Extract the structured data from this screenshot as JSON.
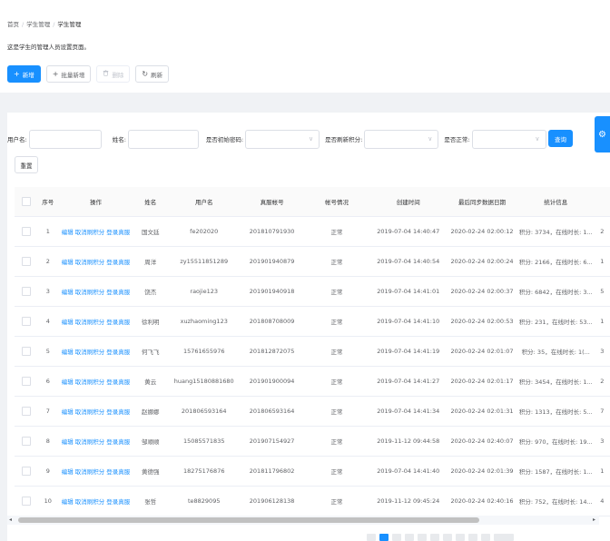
{
  "breadcrumb": [
    "首页",
    "学生管理",
    "学生管理"
  ],
  "description": "这是学生的管理人员设置页面。",
  "toolbar": {
    "add": "新增",
    "batch_add": "批量新增",
    "delete": "删除",
    "refresh": "刷新"
  },
  "filters": {
    "username_label": "用户名:",
    "name_label": "姓名:",
    "init_pwd_label": "是否初始密码:",
    "reset_points_label": "是否刷新积分:",
    "normal_label": "是否正常:",
    "query": "查询",
    "reset": "重置"
  },
  "icons": {
    "add": "plus-icon",
    "batch_add": "plus-icon",
    "delete": "trash-icon",
    "refresh": "refresh-icon",
    "select": "chevron-down-icon",
    "settings": "gear-icon"
  },
  "colors": {
    "primary": "#1890ff"
  },
  "table": {
    "headers": [
      "",
      "序号",
      "操作",
      "姓名",
      "用户名",
      "真服帐号",
      "帐号情况",
      "创建时间",
      "最后同步数据日期",
      "统计信息"
    ],
    "actions": [
      "编辑",
      "取消刷积分",
      "登录真服"
    ],
    "rows": [
      {
        "idx": "1",
        "name": "国文廷",
        "username": "fe202020",
        "account": "201810791930",
        "status": "正常",
        "created": "2019-07-04 14:40:47",
        "synced": "2020-02-24 02:00:12",
        "stats": "积分: 3734，在线时长: 1...",
        "extra": "2"
      },
      {
        "idx": "2",
        "name": "周洋",
        "username": "zy15511851289",
        "account": "201901940879",
        "status": "正常",
        "created": "2019-07-04 14:40:54",
        "synced": "2020-02-24 02:00:24",
        "stats": "积分: 2166，在线时长: 6...",
        "extra": "1"
      },
      {
        "idx": "3",
        "name": "饶杰",
        "username": "raojie123",
        "account": "201901940918",
        "status": "正常",
        "created": "2019-07-04 14:41:01",
        "synced": "2020-02-24 02:00:37",
        "stats": "积分: 6842，在线时长: 3...",
        "extra": "5"
      },
      {
        "idx": "4",
        "name": "徐利明",
        "username": "xuzhaoming123",
        "account": "201808708009",
        "status": "正常",
        "created": "2019-07-04 14:41:10",
        "synced": "2020-02-24 02:00:53",
        "stats": "积分: 231，在线时长: 53...",
        "extra": "1"
      },
      {
        "idx": "5",
        "name": "何飞飞",
        "username": "15761655976",
        "account": "201812872075",
        "status": "正常",
        "created": "2019-07-04 14:41:19",
        "synced": "2020-02-24 02:01:07",
        "stats": "积分: 35，在线时长: 1(...",
        "extra": "3"
      },
      {
        "idx": "6",
        "name": "黄云",
        "username": "huang15180881680",
        "account": "201901900094",
        "status": "正常",
        "created": "2019-07-04 14:41:27",
        "synced": "2020-02-24 02:01:17",
        "stats": "积分: 3454，在线时长: 1...",
        "extra": "2"
      },
      {
        "idx": "7",
        "name": "赵娜娜",
        "username": "201806593164",
        "account": "201806593164",
        "status": "正常",
        "created": "2019-07-04 14:41:34",
        "synced": "2020-02-24 02:01:31",
        "stats": "积分: 1313，在线时长: 5...",
        "extra": "7"
      },
      {
        "idx": "8",
        "name": "邹顺顺",
        "username": "15085571835",
        "account": "201907154927",
        "status": "正常",
        "created": "2019-11-12 09:44:58",
        "synced": "2020-02-24 02:40:07",
        "stats": "积分: 970，在线时长: 19...",
        "extra": "3"
      },
      {
        "idx": "9",
        "name": "黄德强",
        "username": "18275176876",
        "account": "201811796802",
        "status": "正常",
        "created": "2019-07-04 14:41:40",
        "synced": "2020-02-24 02:01:39",
        "stats": "积分: 1587，在线时长: 1...",
        "extra": "1"
      },
      {
        "idx": "10",
        "name": "张哲",
        "username": "te8829095",
        "account": "201906128138",
        "status": "正常",
        "created": "2019-11-12 09:45:24",
        "synced": "2020-02-24 02:40:16",
        "stats": "积分: 752，在线时长: 14...",
        "extra": "4"
      }
    ]
  }
}
